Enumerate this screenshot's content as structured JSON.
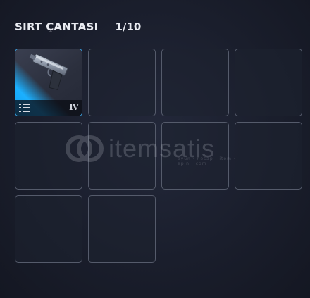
{
  "header": {
    "title": "SIRT ÇANTASI",
    "count": "1/10"
  },
  "slots": [
    {
      "filled": true,
      "item": {
        "icon": "pistol-icon",
        "tier": "IV",
        "menu_icon": "item-menu-icon"
      }
    },
    {
      "filled": false
    },
    {
      "filled": false
    },
    {
      "filled": false
    },
    {
      "filled": false
    },
    {
      "filled": false
    },
    {
      "filled": false
    },
    {
      "filled": false
    },
    {
      "filled": false
    },
    {
      "filled": false
    }
  ],
  "watermark": {
    "text": "itemsatis",
    "subtext": "oyun · hesap · item · epin · com"
  },
  "colors": {
    "background": "#1a1e2c",
    "slot_border": "#555b6b",
    "selected_border": "#3aa6e8",
    "rarity_accent": "#1bb0ff"
  }
}
